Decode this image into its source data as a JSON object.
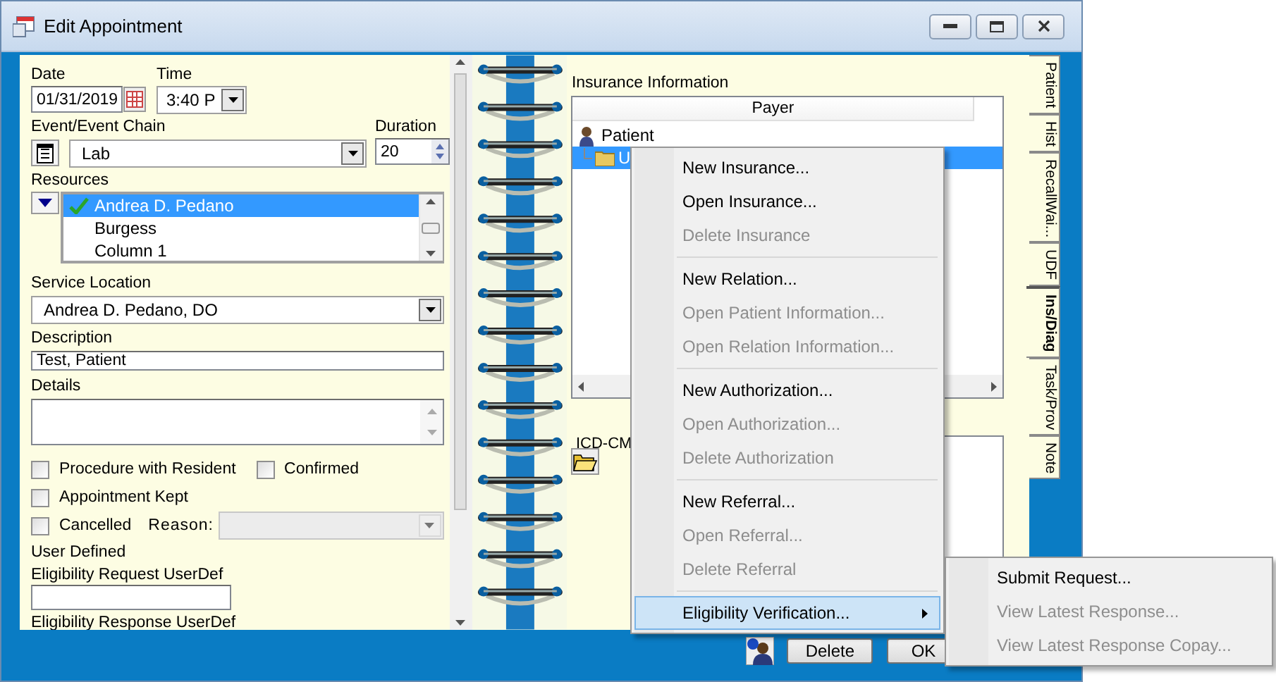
{
  "window": {
    "title": "Edit Appointment"
  },
  "form": {
    "date": {
      "label": "Date",
      "value": "01/31/2019"
    },
    "time": {
      "label": "Time",
      "value": "3:40 P"
    },
    "event": {
      "label": "Event/Event Chain",
      "value": "Lab"
    },
    "duration": {
      "label": "Duration",
      "value": "20"
    },
    "resources": {
      "label": "Resources",
      "items": [
        {
          "name": "Andrea D. Pedano",
          "selected": true,
          "checked": true
        },
        {
          "name": "Burgess",
          "selected": false,
          "checked": false
        },
        {
          "name": "Column 1",
          "selected": false,
          "checked": false
        }
      ]
    },
    "service_location": {
      "label": "Service Location",
      "value": "Andrea D. Pedano, DO"
    },
    "description": {
      "label": "Description",
      "value": "Test, Patient"
    },
    "details": {
      "label": "Details"
    },
    "option_rows": [
      [
        {
          "kind": "checkbox",
          "label": "Procedure with Resident",
          "checked": false
        },
        {
          "kind": "checkbox",
          "label": "Confirmed",
          "checked": false
        }
      ],
      [
        {
          "kind": "checkbox",
          "label": "Appointment Kept",
          "checked": false
        }
      ],
      [
        {
          "kind": "checkbox",
          "label": "Cancelled",
          "checked": false
        },
        {
          "kind": "combo",
          "label": "Reason:",
          "disabled": true
        }
      ]
    ],
    "user_defined": {
      "heading": "User Defined",
      "fields": [
        {
          "label": "Eligibility Request UserDef",
          "kind": "field"
        },
        {
          "label": "Eligibility  Response UserDef",
          "kind": "label"
        }
      ]
    }
  },
  "insurance": {
    "title": "Insurance Information",
    "columns": [
      "Payer"
    ],
    "tree": [
      {
        "label": "Patient",
        "children": [
          {
            "label": "U",
            "selected": true
          }
        ]
      }
    ]
  },
  "icd": {
    "title": "ICD-CM"
  },
  "tabs": [
    {
      "label": "Patient",
      "selected": false
    },
    {
      "label": "Hist",
      "selected": false
    },
    {
      "label": "RecallWai...",
      "selected": false
    },
    {
      "label": "UDF",
      "selected": false
    },
    {
      "label": "Ins/Diag",
      "selected": true
    },
    {
      "label": "Task/Prov",
      "selected": false
    },
    {
      "label": "Note",
      "selected": false
    }
  ],
  "buttons": [
    "Delete",
    "OK"
  ],
  "context_menu": {
    "items": [
      {
        "kind": "item",
        "label": "New Insurance...",
        "disabled": false,
        "selected": false
      },
      {
        "kind": "item",
        "label": "Open Insurance...",
        "disabled": false,
        "selected": false
      },
      {
        "kind": "item",
        "label": "Delete Insurance",
        "disabled": true,
        "selected": false
      },
      {
        "kind": "separator"
      },
      {
        "kind": "item",
        "label": "New Relation...",
        "disabled": false,
        "selected": false
      },
      {
        "kind": "item",
        "label": "Open Patient Information...",
        "disabled": true,
        "selected": false
      },
      {
        "kind": "item",
        "label": "Open Relation Information...",
        "disabled": true,
        "selected": false
      },
      {
        "kind": "separator"
      },
      {
        "kind": "item",
        "label": "New Authorization...",
        "disabled": false,
        "selected": false
      },
      {
        "kind": "item",
        "label": "Open Authorization...",
        "disabled": true,
        "selected": false
      },
      {
        "kind": "item",
        "label": "Delete Authorization",
        "disabled": true,
        "selected": false
      },
      {
        "kind": "separator"
      },
      {
        "kind": "item",
        "label": "New Referral...",
        "disabled": false,
        "selected": false
      },
      {
        "kind": "item",
        "label": "Open Referral...",
        "disabled": true,
        "selected": false
      },
      {
        "kind": "item",
        "label": "Delete Referral",
        "disabled": true,
        "selected": false
      },
      {
        "kind": "separator"
      },
      {
        "kind": "submenu",
        "label": "Eligibility Verification...",
        "disabled": false,
        "selected": true
      }
    ]
  },
  "submenu": {
    "items": [
      {
        "kind": "item",
        "label": "Submit Request...",
        "disabled": false,
        "selected": false
      },
      {
        "kind": "item",
        "label": "View Latest Response...",
        "disabled": true,
        "selected": false
      },
      {
        "kind": "item",
        "label": "View Latest Response Copay...",
        "disabled": true,
        "selected": false
      }
    ]
  }
}
